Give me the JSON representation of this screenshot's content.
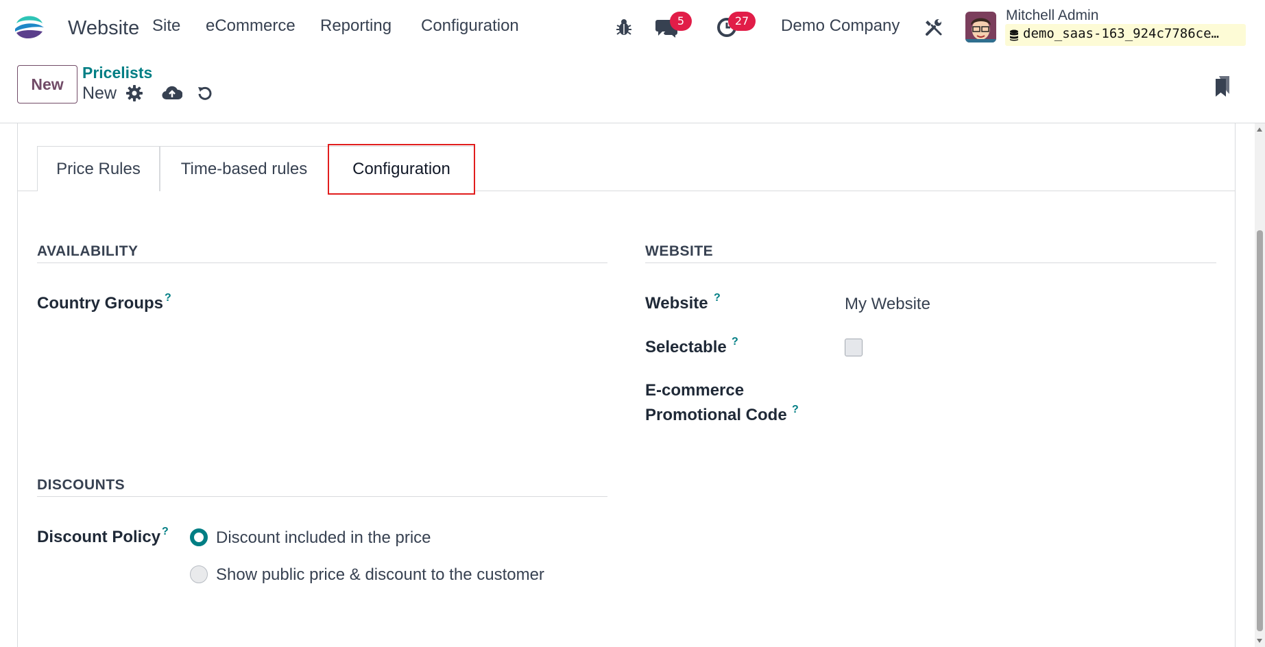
{
  "navbar": {
    "app_name": "Website",
    "menu": [
      "Site",
      "eCommerce",
      "Reporting",
      "Configuration"
    ],
    "messages_count": "5",
    "activities_count": "27",
    "company": "Demo Company",
    "user_name": "Mitchell Admin",
    "database": "demo_saas-163_924c7786ce…"
  },
  "control_panel": {
    "new_label": "New",
    "breadcrumb": "Pricelists",
    "record_name": "New"
  },
  "tabs": {
    "price_rules": "Price Rules",
    "time_based": "Time-based rules",
    "configuration": "Configuration",
    "active": "configuration"
  },
  "availability": {
    "title": "AVAILABILITY",
    "country_groups_label": "Country Groups"
  },
  "website_section": {
    "title": "WEBSITE",
    "website_label": "Website",
    "website_value": "My Website",
    "selectable_label": "Selectable",
    "selectable_checked": false,
    "promo_label_line1": "E-commerce",
    "promo_label_line2": "Promotional Code"
  },
  "discounts": {
    "title": "DISCOUNTS",
    "policy_label": "Discount Policy",
    "option_included": "Discount included in the price",
    "option_public": "Show public price & discount to the customer",
    "selected": "option_included"
  },
  "help_marker": "?",
  "colors": {
    "brand_purple": "#714b67",
    "teal": "#017e84",
    "badge_red": "#e11d48",
    "highlight_red": "#e11d1d"
  }
}
